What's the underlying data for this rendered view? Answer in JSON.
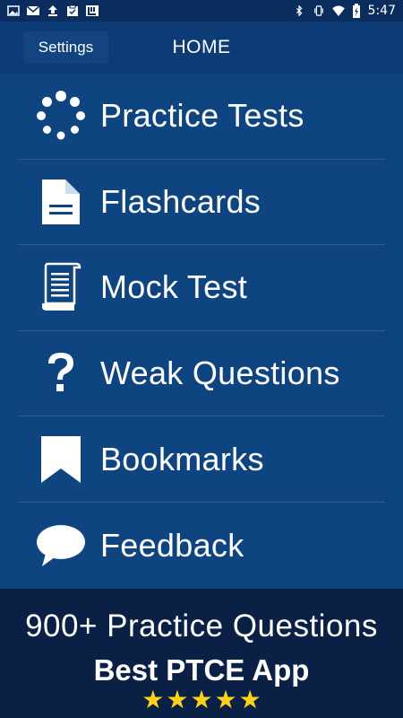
{
  "status_bar": {
    "time": "5:47",
    "left_icons": [
      "image-icon",
      "mail-icon",
      "upload-icon",
      "clipboard-icon",
      "app-icon"
    ],
    "right_icons": [
      "bluetooth-icon",
      "vibrate-icon",
      "wifi-icon",
      "battery-icon"
    ]
  },
  "app_bar": {
    "settings_label": "Settings",
    "title": "HOME"
  },
  "menu": {
    "items": [
      {
        "label": "Practice Tests",
        "icon": "spinner-icon"
      },
      {
        "label": "Flashcards",
        "icon": "document-icon"
      },
      {
        "label": "Mock Test",
        "icon": "scroll-icon"
      },
      {
        "label": "Weak Questions",
        "icon": "question-icon"
      },
      {
        "label": "Bookmarks",
        "icon": "bookmark-icon"
      },
      {
        "label": "Feedback",
        "icon": "speech-bubble-icon"
      }
    ]
  },
  "banner": {
    "line1": "900+ Practice Questions",
    "line2": "Best PTCE App",
    "rating_stars": 5,
    "star_color": "#ffd21a"
  },
  "colors": {
    "status_bar": "#0a2d5e",
    "app_bar": "#0c3b75",
    "menu_bg": "#0e4581",
    "banner_bg": "#0a2145"
  }
}
